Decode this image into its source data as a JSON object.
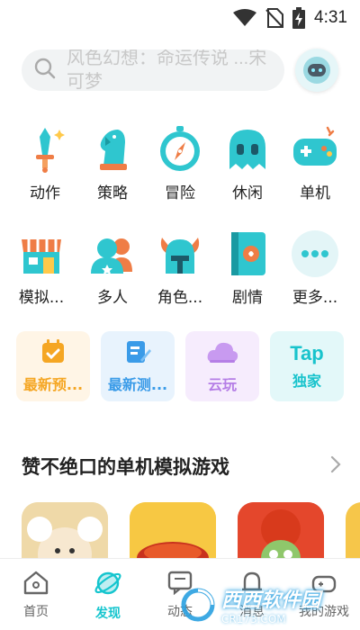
{
  "status_bar": {
    "time": "4:31"
  },
  "search": {
    "hint": "风色幻想：命运传说 ...宋可梦"
  },
  "categories_row1": [
    {
      "label": "动作",
      "icon": "sword-icon"
    },
    {
      "label": "策略",
      "icon": "chess-knight-icon"
    },
    {
      "label": "冒险",
      "icon": "compass-icon"
    },
    {
      "label": "休闲",
      "icon": "ghost-icon"
    },
    {
      "label": "单机",
      "icon": "gamepad-icon"
    }
  ],
  "categories_row2": [
    {
      "label": "模拟...",
      "icon": "shop-icon"
    },
    {
      "label": "多人",
      "icon": "people-icon"
    },
    {
      "label": "角色...",
      "icon": "viking-helmet-icon"
    },
    {
      "label": "剧情",
      "icon": "book-icon"
    },
    {
      "label": "更多...",
      "icon": "more-dots-icon"
    }
  ],
  "quick_links": [
    {
      "label": "最新预...",
      "color": "#f5a623",
      "bg": "#fff5e6",
      "icon": "calendar-check-icon"
    },
    {
      "label": "最新测...",
      "color": "#3a9be8",
      "bg": "#e8f3fd",
      "icon": "edit-note-icon"
    },
    {
      "label": "云玩",
      "color": "#b57ee6",
      "bg": "#f6ecfd",
      "icon": "cloud-icon"
    },
    {
      "label": "独家",
      "logo": "Tap",
      "color": "#18c3cc",
      "bg": "#e3f8f9",
      "icon": "tap-logo-icon"
    }
  ],
  "section": {
    "title": "赞不绝口的单机模拟游戏"
  },
  "tabs": [
    {
      "label": "首页",
      "icon": "home-icon",
      "active": false
    },
    {
      "label": "发现",
      "icon": "planet-icon",
      "active": true
    },
    {
      "label": "动态",
      "icon": "chat-card-icon",
      "active": false
    },
    {
      "label": "消息",
      "icon": "bell-icon",
      "active": false
    },
    {
      "label": "我的游戏",
      "icon": "gamepad-tab-icon",
      "active": false
    }
  ],
  "watermark": {
    "text": "西西软件园",
    "sub": "CR173.COM"
  },
  "colors": {
    "accent": "#15c5ce"
  }
}
